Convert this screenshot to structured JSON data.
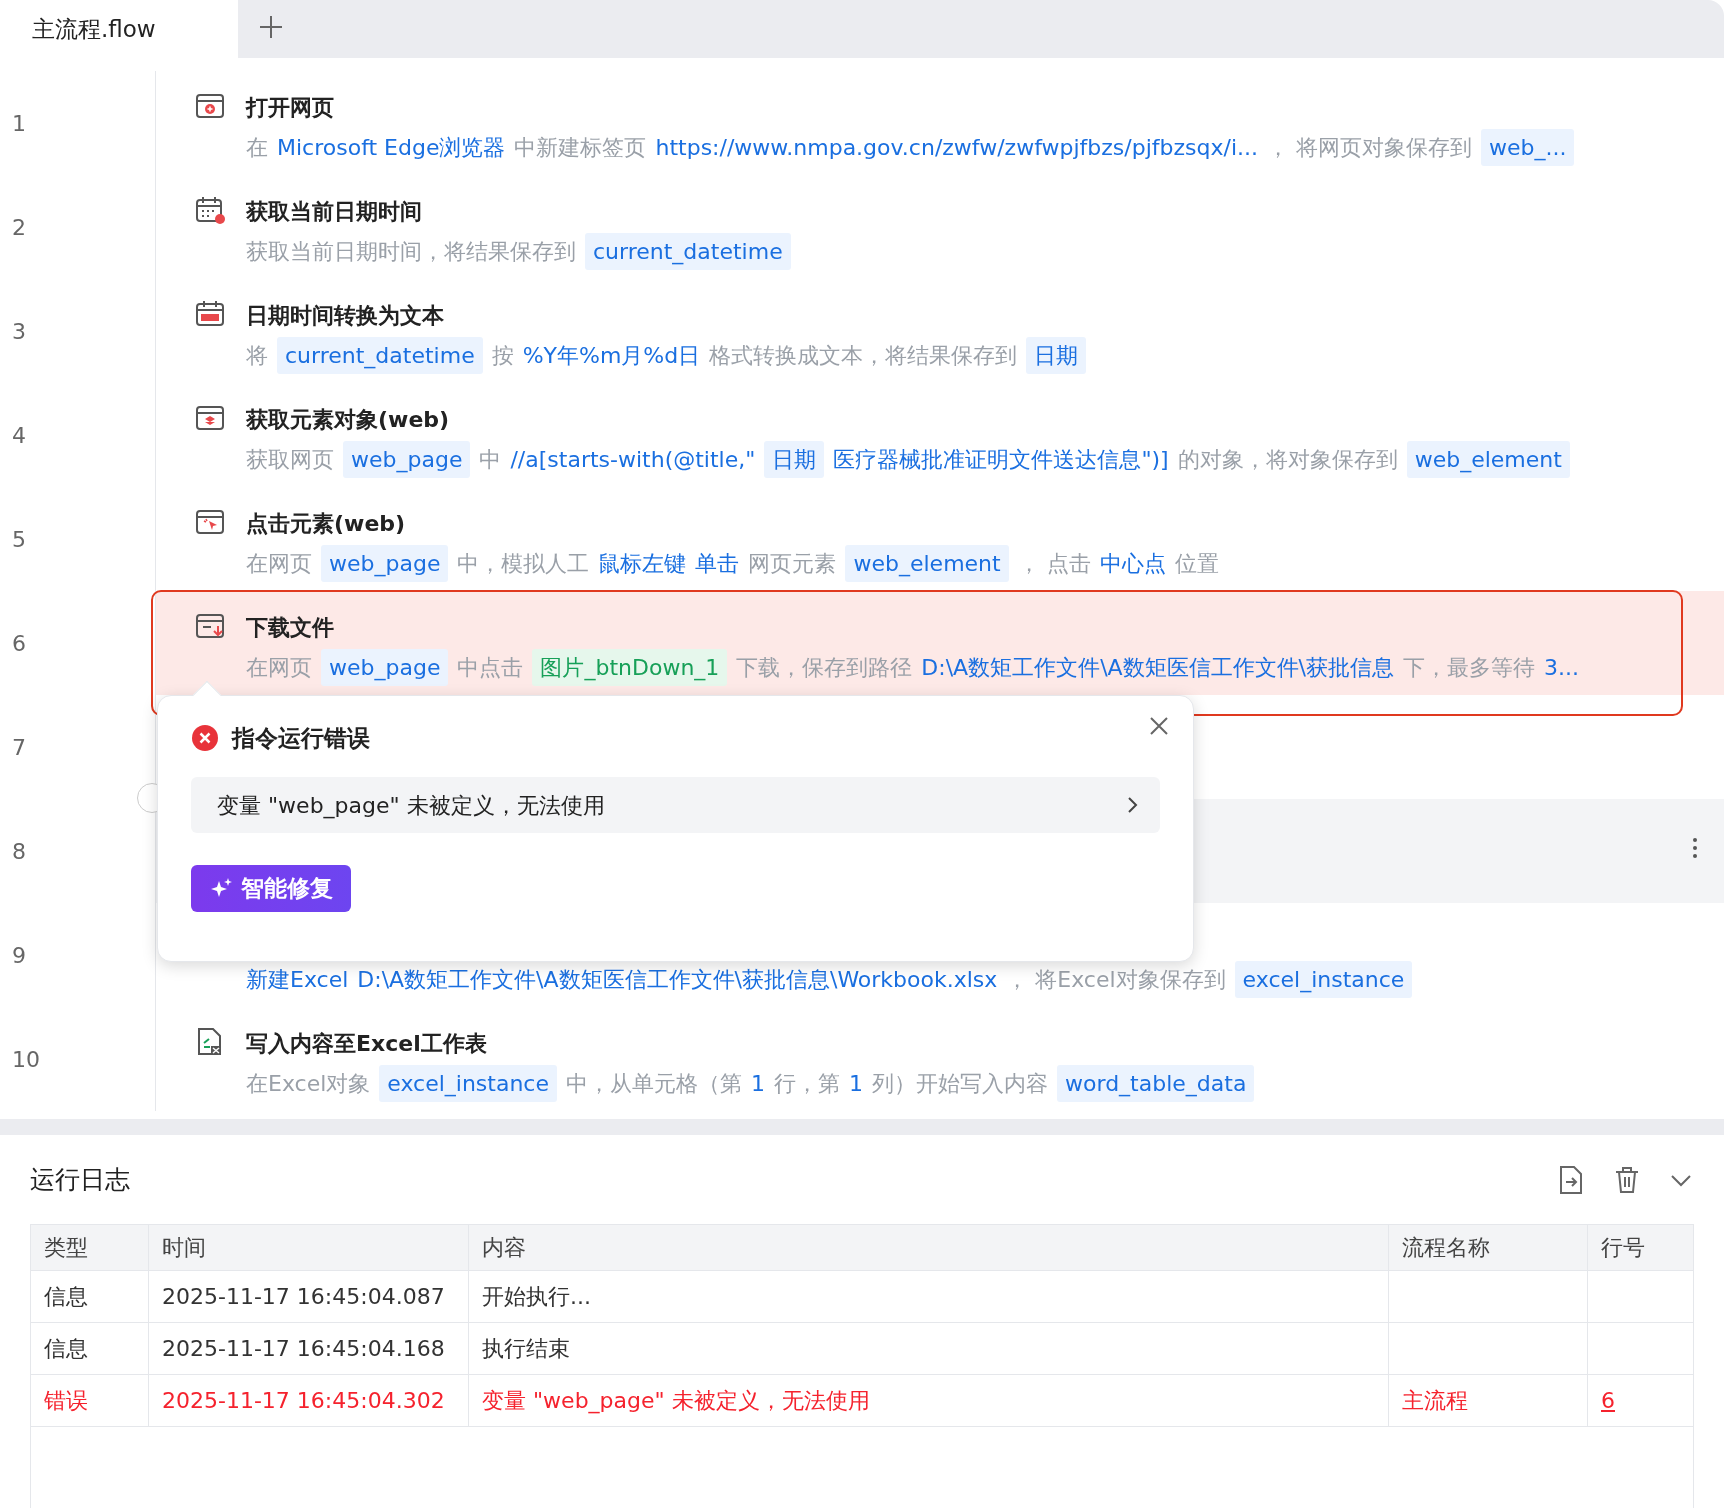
{
  "tabs": [
    {
      "label": "主流程.flow",
      "selected": true
    }
  ],
  "steps": [
    {
      "line": "1",
      "kind": "browser-open",
      "title": "打开网页",
      "error": false,
      "hovered": false,
      "description": [
        {
          "kind": "text",
          "text": "在"
        },
        {
          "kind": "value",
          "text": "Microsoft Edge浏览器"
        },
        {
          "kind": "text",
          "text": "中新建标签页"
        },
        {
          "kind": "value",
          "text": "https://www.nmpa.gov.cn/zwfw/zwfwpjfbzs/pjfbzsqx/i..."
        },
        {
          "kind": "text",
          "text": "， 将网页对象保存到"
        },
        {
          "kind": "var",
          "text": "web_..."
        }
      ]
    },
    {
      "line": "2",
      "kind": "calendar-clock",
      "title": "获取当前日期时间",
      "error": false,
      "hovered": false,
      "description": [
        {
          "kind": "text",
          "text": "获取当前日期时间，将结果保存到"
        },
        {
          "kind": "var",
          "text": "current_datetime"
        }
      ]
    },
    {
      "line": "3",
      "kind": "calendar",
      "title": "日期时间转换为文本",
      "error": false,
      "hovered": false,
      "description": [
        {
          "kind": "text",
          "text": "将"
        },
        {
          "kind": "var",
          "text": "current_datetime"
        },
        {
          "kind": "text",
          "text": "按"
        },
        {
          "kind": "value",
          "text": "%Y年%m月%d日"
        },
        {
          "kind": "text",
          "text": "格式转换成文本，将结果保存到"
        },
        {
          "kind": "var",
          "text": "日期"
        }
      ]
    },
    {
      "line": "4",
      "kind": "browser-element",
      "title": "获取元素对象(web)",
      "error": false,
      "hovered": false,
      "description": [
        {
          "kind": "text",
          "text": "获取网页"
        },
        {
          "kind": "var",
          "text": "web_page"
        },
        {
          "kind": "text",
          "text": "中"
        },
        {
          "kind": "value",
          "text": "//a[starts-with(@title,\""
        },
        {
          "kind": "var",
          "text": "日期"
        },
        {
          "kind": "value",
          "text": "医疗器械批准证明文件送达信息\")]"
        },
        {
          "kind": "text",
          "text": "的对象，将对象保存到"
        },
        {
          "kind": "var",
          "text": "web_element"
        }
      ]
    },
    {
      "line": "5",
      "kind": "browser-click",
      "title": "点击元素(web)",
      "error": false,
      "hovered": false,
      "description": [
        {
          "kind": "text",
          "text": "在网页"
        },
        {
          "kind": "var",
          "text": "web_page"
        },
        {
          "kind": "text",
          "text": "中，模拟人工"
        },
        {
          "kind": "value",
          "text": "鼠标左键"
        },
        {
          "kind": "value",
          "text": "单击"
        },
        {
          "kind": "text",
          "text": "网页元素"
        },
        {
          "kind": "var",
          "text": "web_element"
        },
        {
          "kind": "text",
          "text": "， 点击"
        },
        {
          "kind": "value",
          "text": "中心点"
        },
        {
          "kind": "text",
          "text": "位置"
        }
      ]
    },
    {
      "line": "6",
      "kind": "browser-download",
      "title": "下载文件",
      "error": true,
      "hovered": false,
      "description": [
        {
          "kind": "text",
          "text": "在网页"
        },
        {
          "kind": "var",
          "text": "web_page"
        },
        {
          "kind": "text",
          "text": "中点击"
        },
        {
          "kind": "element",
          "text": "图片_btnDown_1"
        },
        {
          "kind": "text",
          "text": "下载，保存到路径"
        },
        {
          "kind": "value",
          "text": "D:\\A数矩工作文件\\A数矩医信工作文件\\获批信息"
        },
        {
          "kind": "text",
          "text": "下，最多等待"
        },
        {
          "kind": "value",
          "text": "3..."
        }
      ]
    },
    {
      "line": "7",
      "error": false,
      "hovered": false
    },
    {
      "line": "8",
      "error": false,
      "hovered": true
    },
    {
      "line": "9",
      "error": false,
      "hovered": false,
      "description": [
        {
          "kind": "value",
          "text": "新建Excel"
        },
        {
          "kind": "value",
          "text": "D:\\A数矩工作文件\\A数矩医信工作文件\\获批信息\\Workbook.xlsx"
        },
        {
          "kind": "text",
          "text": "， 将Excel对象保存到"
        },
        {
          "kind": "var",
          "text": "excel_instance"
        }
      ]
    },
    {
      "line": "10",
      "kind": "excel-file",
      "title": "写入内容至Excel工作表",
      "error": false,
      "hovered": false,
      "description": [
        {
          "kind": "text",
          "text": "在Excel对象"
        },
        {
          "kind": "var",
          "text": "excel_instance"
        },
        {
          "kind": "text",
          "text": "中，从单元格（第"
        },
        {
          "kind": "value",
          "text": "1"
        },
        {
          "kind": "text",
          "text": "行，第"
        },
        {
          "kind": "value",
          "text": "1"
        },
        {
          "kind": "text",
          "text": "列）开始写入内容"
        },
        {
          "kind": "var",
          "text": "word_table_data"
        }
      ]
    }
  ],
  "error_popover": {
    "title": "指令运行错误",
    "message": "变量 \"web_page\" 未被定义，无法使用",
    "fix_button": "智能修复"
  },
  "log": {
    "title": "运行日志",
    "columns": [
      "类型",
      "时间",
      "内容",
      "流程名称",
      "行号"
    ],
    "rows": [
      {
        "error": false,
        "type": "信息",
        "time": "2025-11-17 16:45:04.087",
        "content": "开始执行..."
      },
      {
        "error": false,
        "type": "信息",
        "time": "2025-11-17 16:45:04.168",
        "content": "执行结束"
      },
      {
        "error": true,
        "type": "错误",
        "time": "2025-11-17 16:45:04.302",
        "content": "变量 \"web_page\" 未被定义，无法使用",
        "flow": "主流程",
        "line": "6"
      }
    ]
  }
}
